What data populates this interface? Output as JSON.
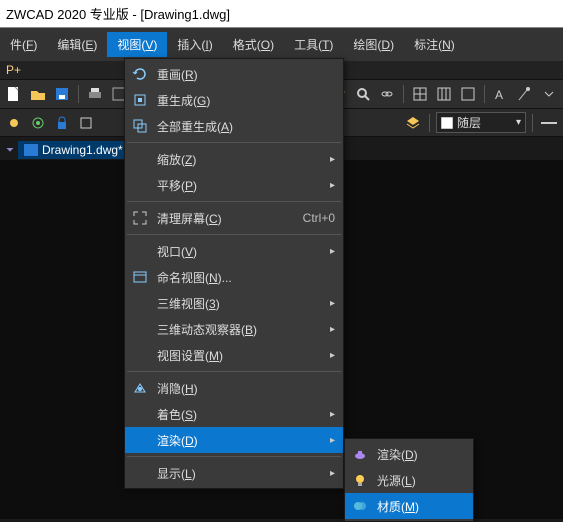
{
  "title": "ZWCAD 2020 专业版 - [Drawing1.dwg]",
  "menubar": {
    "file": {
      "pre": "件(",
      "hot": "F",
      "post": ")"
    },
    "edit": {
      "pre": "编辑(",
      "hot": "E",
      "post": ")"
    },
    "view": {
      "pre": "视图(",
      "hot": "V",
      "post": ")"
    },
    "insert": {
      "pre": "插入(",
      "hot": "I",
      "post": ")"
    },
    "format": {
      "pre": "格式(",
      "hot": "O",
      "post": ")"
    },
    "tools": {
      "pre": "工具(",
      "hot": "T",
      "post": ")"
    },
    "draw": {
      "pre": "绘图(",
      "hot": "D",
      "post": ")"
    },
    "dim": {
      "pre": "标注(",
      "hot": "N",
      "post": ")"
    }
  },
  "subline": "P+",
  "layer_combo": {
    "label": "随层",
    "arrow": "▾"
  },
  "doc_tab": {
    "label": "Drawing1.dwg*",
    "close": "⏷"
  },
  "view_menu": {
    "redraw": {
      "pre": "重画(",
      "hot": "R",
      "post": ")"
    },
    "regen": {
      "pre": "重生成(",
      "hot": "G",
      "post": ")"
    },
    "regenall": {
      "pre": "全部重生成(",
      "hot": "A",
      "post": ")"
    },
    "zoom": {
      "pre": "缩放(",
      "hot": "Z",
      "post": ")"
    },
    "pan": {
      "pre": "平移(",
      "hot": "P",
      "post": ")"
    },
    "clean": {
      "pre": "清理屏幕(",
      "hot": "C",
      "post": ")"
    },
    "clean_sc": "Ctrl+0",
    "viewport": {
      "pre": "视口(",
      "hot": "V",
      "post": ")"
    },
    "namedview": {
      "pre": "命名视图(",
      "hot": "N",
      "post": ")..."
    },
    "view3d": {
      "pre": "三维视图(",
      "hot": "3",
      "post": ")"
    },
    "orbit3d": {
      "pre": "三维动态观察器(",
      "hot": "B",
      "post": ")"
    },
    "viewset": {
      "pre": "视图设置(",
      "hot": "M",
      "post": ")"
    },
    "hide": {
      "pre": "消隐(",
      "hot": "H",
      "post": ")"
    },
    "shade": {
      "pre": "着色(",
      "hot": "S",
      "post": ")"
    },
    "render": {
      "pre": "渲染(",
      "hot": "D",
      "post": ")"
    },
    "display": {
      "pre": "显示(",
      "hot": "L",
      "post": ")"
    }
  },
  "render_submenu": {
    "render": {
      "pre": "渲染(",
      "hot": "D",
      "post": ")"
    },
    "light": {
      "pre": "光源(",
      "hot": "L",
      "post": ")"
    },
    "material": {
      "pre": "材质(",
      "hot": "M",
      "post": ")"
    }
  },
  "arrow_glyph": "▸"
}
